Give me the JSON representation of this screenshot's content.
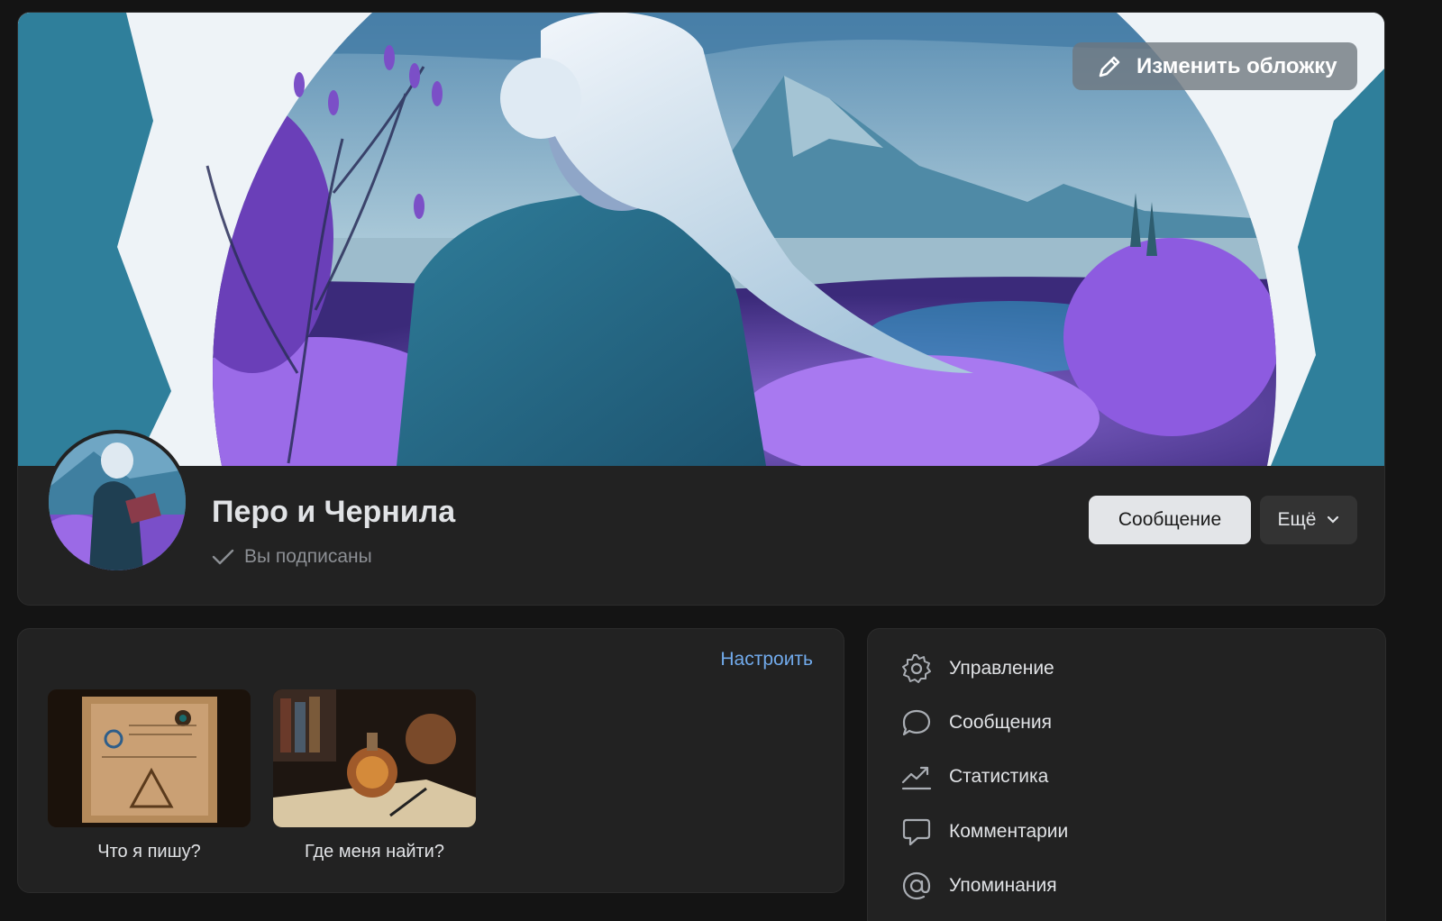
{
  "cover": {
    "edit_label": "Изменить обложку"
  },
  "profile": {
    "name": "Перо и Чернила",
    "subscription_status": "Вы подписаны",
    "message_button": "Сообщение",
    "more_button": "Ещё"
  },
  "pinned": {
    "configure_label": "Настроить",
    "items": [
      {
        "label": "Что я пишу?"
      },
      {
        "label": "Где меня найти?"
      }
    ]
  },
  "admin_menu": {
    "items": [
      {
        "label": "Управление",
        "icon": "gear-icon"
      },
      {
        "label": "Сообщения",
        "icon": "chat-bubble-icon"
      },
      {
        "label": "Статистика",
        "icon": "stats-chart-icon"
      },
      {
        "label": "Комментарии",
        "icon": "comment-icon"
      },
      {
        "label": "Упоминания",
        "icon": "at-sign-icon"
      }
    ]
  },
  "colors": {
    "background": "#141414",
    "card": "#222222",
    "accent_link": "#71aaeb",
    "text_primary": "#e1e3e6",
    "text_secondary": "#8c8f94"
  }
}
